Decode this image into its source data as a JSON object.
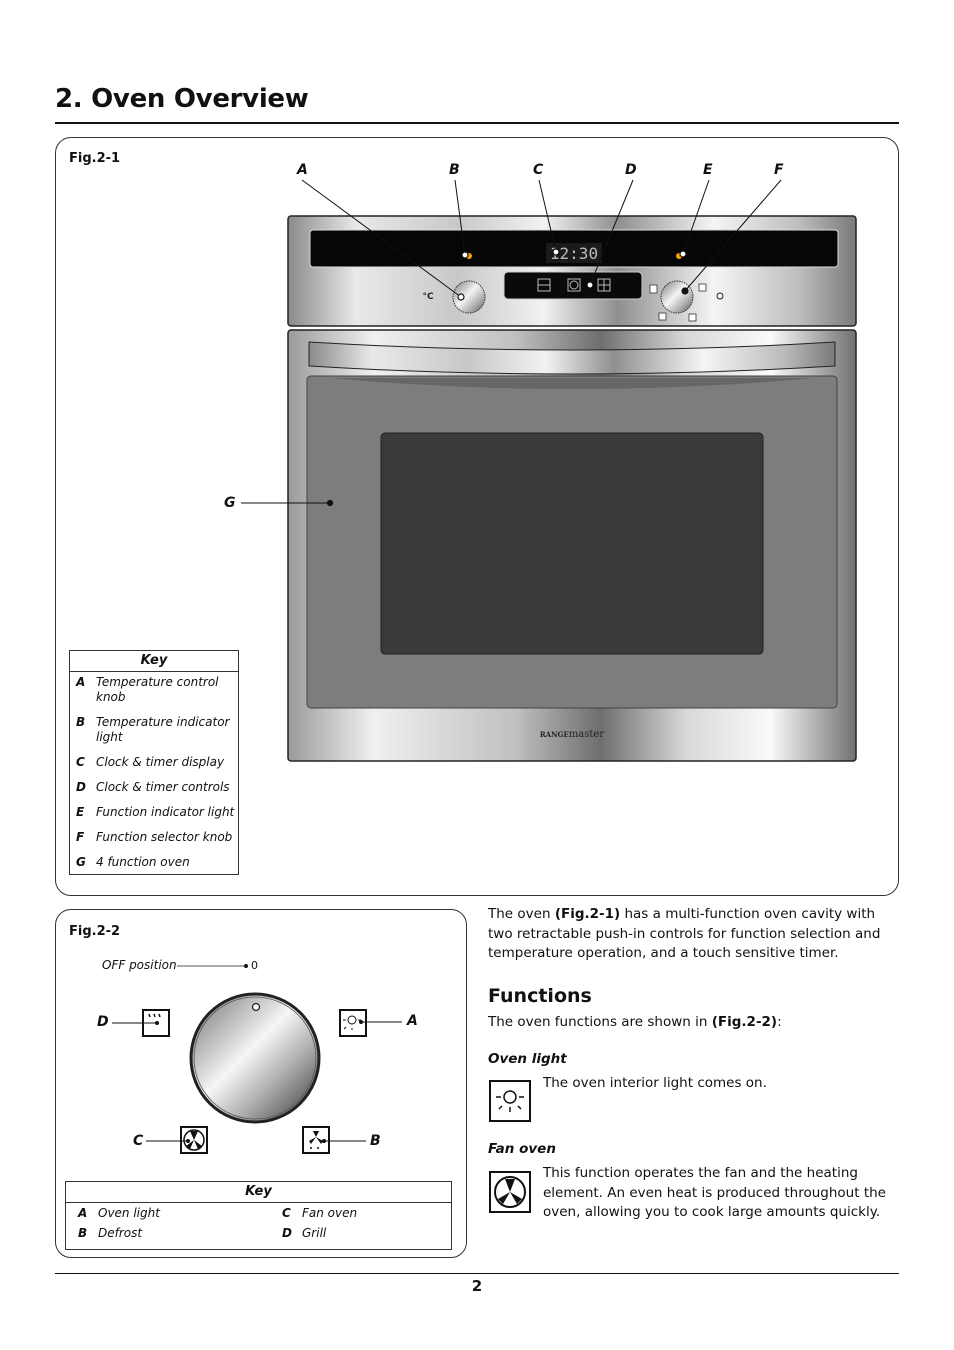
{
  "page": {
    "title": "2.  Oven Overview",
    "page_number": "2"
  },
  "fig1": {
    "label": "Fig.2-1",
    "callouts": [
      "A",
      "B",
      "C",
      "D",
      "E",
      "F",
      "G"
    ],
    "display_time": "12:30",
    "temp_unit": "°C",
    "brand_caps": "RANGE",
    "brand_lower": "master",
    "key": {
      "title": "Key",
      "items": [
        {
          "letter": "A",
          "text": "Temperature control knob"
        },
        {
          "letter": "B",
          "text": "Temperature indicator light"
        },
        {
          "letter": "C",
          "text": "Clock & timer display"
        },
        {
          "letter": "D",
          "text": "Clock & timer controls"
        },
        {
          "letter": "E",
          "text": "Function indicator light"
        },
        {
          "letter": "F",
          "text": "Function selector knob"
        },
        {
          "letter": "G",
          "text": "4 function oven"
        }
      ]
    }
  },
  "fig2": {
    "label": "Fig.2-2",
    "off_label": "OFF position",
    "off_value": "0",
    "callouts": {
      "A": "A",
      "B": "B",
      "C": "C",
      "D": "D"
    },
    "key": {
      "title": "Key",
      "items": [
        {
          "letter": "A",
          "text": "Oven light"
        },
        {
          "letter": "C",
          "text": "Fan oven"
        },
        {
          "letter": "B",
          "text": "Defrost"
        },
        {
          "letter": "D",
          "text": "Grill"
        }
      ]
    }
  },
  "intro": {
    "pre": "The oven ",
    "ref": "(Fig.2-1)",
    "post": " has a multi-function oven cavity with two retractable push-in controls for function selection and temperature operation, and a touch sensitive timer."
  },
  "functions": {
    "heading": "Functions",
    "intro_pre": "The oven functions are shown in ",
    "intro_ref": "(Fig.2-2)",
    "intro_post": ":",
    "items": [
      {
        "title": "Oven light",
        "icon": "oven-light-icon",
        "text": "The oven interior light comes on."
      },
      {
        "title": "Fan oven",
        "icon": "fan-oven-icon",
        "text": "This function operates the fan and the heating element. An even heat is produced throughout the oven, allowing you to cook large amounts quickly."
      }
    ]
  }
}
